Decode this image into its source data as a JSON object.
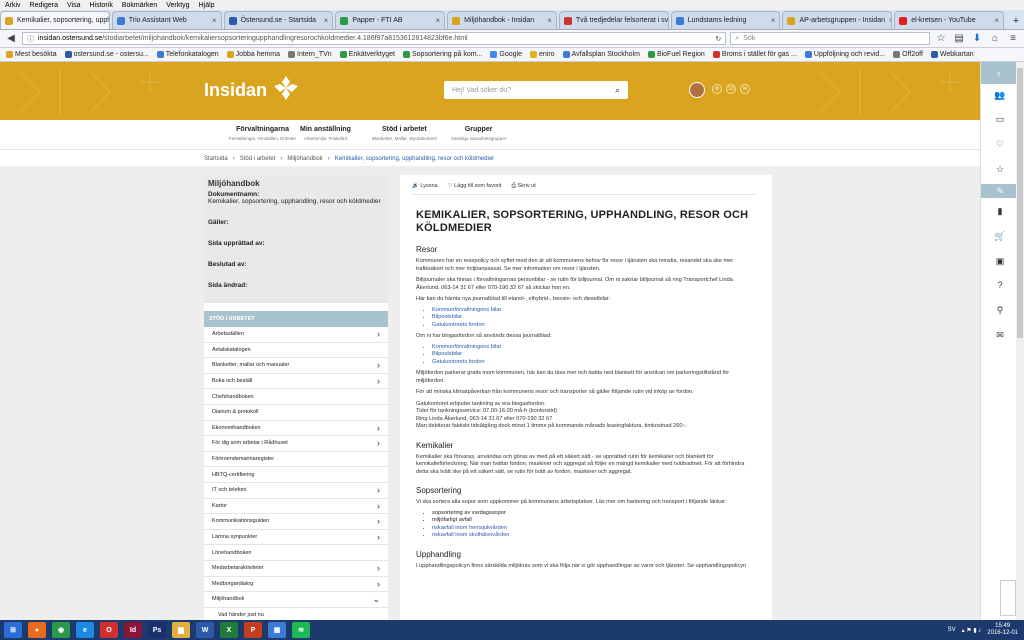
{
  "menubar": [
    "Arkiv",
    "Redigera",
    "Visa",
    "Historik",
    "Bokmärken",
    "Verktyg",
    "Hjälp"
  ],
  "tabs": [
    {
      "label": "Kemikalier, sopsortering, upph...",
      "active": true,
      "color": "#d9a41f"
    },
    {
      "label": "Trio Assistant Web",
      "color": "#3a7bd5"
    },
    {
      "label": "Östersund.se - Startsida",
      "color": "#2a5aa8"
    },
    {
      "label": "Papper - FTI AB",
      "color": "#2a9a4a"
    },
    {
      "label": "Miljöhandbok - Insidan",
      "color": "#d9a41f"
    },
    {
      "label": "Två tredjedelar felsorterat i sve...",
      "color": "#c33"
    },
    {
      "label": "Lundstams ledning",
      "color": "#3a7bd5"
    },
    {
      "label": "AP-arbetsgruppen - Insidan",
      "color": "#d9a41f"
    },
    {
      "label": "el-kretsen - YouTube",
      "color": "#e02020"
    }
  ],
  "url": {
    "domain": "insidan.ostersund.se",
    "path": "/stodiarbetet/miljohandbok/kemikaliersopsorteringupphandlingresorochkoldmedier.4.186f97a8153612814823bf6e.html"
  },
  "search": {
    "placeholder": "Sök"
  },
  "bookmarks": [
    "Mest besökta",
    "ostersund.se - ostersu...",
    "Telefonkatalogen",
    "Jobba hemma",
    "Intern_TVn",
    "Enkätverktyget",
    "Sopsortering på kom...",
    "Google",
    "eniro",
    "Avfallsplan Stockholm",
    "BioFuel Region",
    "Broms i stället för gas ...",
    "Uppföljning och revid...",
    "Off2off",
    "Webkartan"
  ],
  "site": {
    "logo": "Insidan",
    "search_placeholder": "Hej! Vad söker du?",
    "badge": "10"
  },
  "mainnav": [
    {
      "title": "Förvaltningarna",
      "sub": "Förvaltningar, Omställen, Enheter"
    },
    {
      "title": "Min anställning",
      "sub": "Arbetsmiljö, Friskvård"
    },
    {
      "title": "Stöd i arbetet",
      "sub": "Blanketter, Mallar, Styrdokument"
    },
    {
      "title": "Grupper",
      "sub": "Samtliga samarbetsgrupper"
    }
  ],
  "breadcrumbs": [
    "Startsida",
    "Stöd i arbetet",
    "Miljöhandbok",
    "Kemikalier, sopsortering, upphandling, resor och köldmedier"
  ],
  "doc": {
    "heading": "Miljöhandbok",
    "name_label": "Dokumentnamn:",
    "name": "Kemikalier, sopsortering, upphandling, resor och köldmedier",
    "valid": "Gäller:",
    "updated": "Sida upprättad av:",
    "decided": "Beslutad av:",
    "changed": "Sida ändrad:"
  },
  "sidebar": {
    "heading": "STÖD I ARBETET",
    "items": [
      {
        "label": "Arbetsställen",
        "chev": true
      },
      {
        "label": "Avtalskatalogen",
        "chev": false
      },
      {
        "label": "Blanketter, mallar och manualer",
        "chev": true
      },
      {
        "label": "Boka och beställ",
        "chev": true
      },
      {
        "label": "Chefshandboken",
        "chev": false
      },
      {
        "label": "Diarium & protokoll",
        "chev": false
      },
      {
        "label": "Ekonomihandboken",
        "chev": true
      },
      {
        "label": "För dig som arbetar i Rådhuset",
        "chev": true
      },
      {
        "label": "Förtroendemannaregister",
        "chev": false
      },
      {
        "label": "HBTQ-certifiering",
        "chev": false
      },
      {
        "label": "IT och telefoni",
        "chev": true
      },
      {
        "label": "Kartor",
        "chev": true
      },
      {
        "label": "Kommunikationsguiden",
        "chev": true
      },
      {
        "label": "Lämna synpunkter",
        "chev": true
      },
      {
        "label": "Lönehandboken",
        "chev": false
      },
      {
        "label": "Medarbetaraktiviteter",
        "chev": true
      },
      {
        "label": "Medborgardialog",
        "chev": true
      },
      {
        "label": "Miljöhandbok",
        "chev": true
      },
      {
        "label": "Vad händer just nu",
        "chev": false
      }
    ]
  },
  "tools": [
    "Lyssna",
    "Lägg till som favorit",
    "Skriv ut"
  ],
  "article": {
    "title": "KEMIKALIER, SOPSORTERING, UPPHANDLING, RESOR OCH KÖLDMEDIER",
    "h_resor": "Resor",
    "p1": "Kommunen har en resepolicy och syftet med den är att kommunens behov för resor i tjänsten ska minska, resandet ska ske mer trafiksäkert och mer miljöanpassat. Se mer information om resor i tjänsten.",
    "p2": "Bilijournaler ska finnas i förvaltningarnas personbilar - se rutin för bilijournal. Om ni saknar bilijournal så ring Transportchef Linda Åkerlund, 063-14 31 67 eller 070-190 32 67 så skickar hon en.",
    "p3": "Här kan du hämta nya journalblad till etanol-, elhybrid-, bensin- och dieselbilar:",
    "list1": [
      "Kommunförvaltningens bilar",
      "Bilpoolsbilar",
      "Gatukontorets fordon"
    ],
    "p4": "Om ni har biogasfordon så används dessa journalblad:",
    "list2": [
      "Kommunförvaltningens bilar",
      "Bilpoolsbilar",
      "Gatukontorets fordon"
    ],
    "p5": "Miljöfordon parkerar gratis inom kommunen, här kan du läsa mer och ladda ned blankett för ansökan om parkeringstillstånd för miljöfordon.",
    "p6": "För att minska klimatpåverkan från kommunens resor och transporter så gäller följande rutin vid inköp av fordon.",
    "p7": "Gatukontoret erbjuder tankning av era biogasfordon.",
    "p8": "Tider för tankningsservice: 07.00-16.00 må-fr (kontorstid)",
    "p9": "Ring Linda Åkerlund, 063-14 31 67 eller 070-190 32 67",
    "p10": "Man debiterar faktiskt tidsåtgång dock minst 1 timme på kommande månads leasingfaktura, timkostnad 260:-.",
    "h_kem": "Kemikalier",
    "p11": "Kemikalier ska förvaras, användas och göras av med på ett säkert sätt - se upprättad rutin för kemikalier och blankett för kemikalieförteckning. När man tvättar fordon, maskiner och aggregat så följer en mängd kemikalier med tvättvattnet. För att förhindra detta ska tvätt ske på ett säkert sätt, se rutin för tvätt av fordon, maskiner och aggregat.",
    "h_sop": "Sopsortering",
    "p12": "Vi ska sortera alla sopor som uppkommer på kommunens arbetsplatser. Läs mer om hantering och transport i följande länkar:",
    "list3": [
      "sopsortering av vardagssopor",
      "miljöfarligt avfall",
      "riskavfall inom hemsjukvården",
      "riskavfall inom skolhälsovården"
    ],
    "h_upph": "Upphandling",
    "p13": "I upphandlingspolicyn finns särskilda miljökrav som vi ska följa när vi gör upphandlingar av varor och tjänster. Se upphandlingspolicyn"
  },
  "tray": {
    "lang": "SV",
    "time": "15:49",
    "date": "2016-12-01"
  }
}
